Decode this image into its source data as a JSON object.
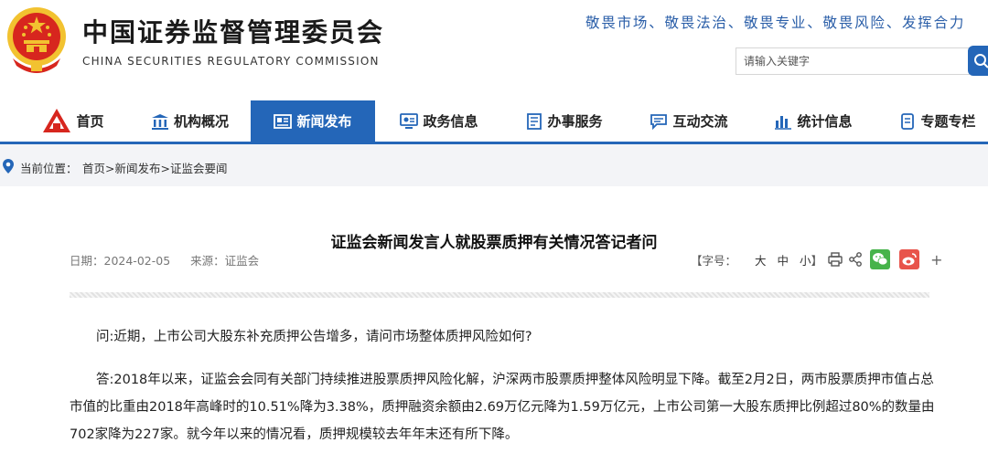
{
  "header": {
    "org_name_cn": "中国证券监督管理委员会",
    "org_name_en": "CHINA SECURITIES REGULATORY COMMISSION",
    "slogan": "敬畏市场、敬畏法治、敬畏专业、敬畏风险、发挥合力",
    "search_placeholder": "请输入关键字"
  },
  "nav": {
    "items": [
      {
        "label": "首页",
        "icon": "emblem-home-icon"
      },
      {
        "label": "机构概况",
        "icon": "building-icon"
      },
      {
        "label": "新闻发布",
        "icon": "news-icon",
        "active": true
      },
      {
        "label": "政务信息",
        "icon": "monitor-icon"
      },
      {
        "label": "办事服务",
        "icon": "form-icon"
      },
      {
        "label": "互动交流",
        "icon": "chat-icon"
      },
      {
        "label": "统计信息",
        "icon": "bar-chart-icon"
      },
      {
        "label": "专题专栏",
        "icon": "document-icon"
      }
    ]
  },
  "breadcrumb": {
    "label": "当前位置：",
    "path": "首页>新闻发布>证监会要闻"
  },
  "article": {
    "title": "证监会新闻发言人就股票质押有关情况答记者问",
    "date": "日期：2024-02-05",
    "source": "来源：证监会",
    "font_size_label": "【字号：",
    "font_sizes": [
      "大",
      "中",
      "小"
    ],
    "font_size_close": "】",
    "plus": "+",
    "paragraphs": [
      "问:近期，上市公司大股东补充质押公告增多，请问市场整体质押风险如何?",
      "答:2018年以来，证监会会同有关部门持续推进股票质押风险化解，沪深两市股票质押整体风险明显下降。截至2月2日，两市股票质押市值占总市值的比重由2018年高峰时的10.51%降为3.38%，质押融资余额由2.69万亿元降为1.59万亿元，上市公司第一大股东质押比例超过80%的数量由702家降为227家。就今年以来的情况看，质押规模较去年年末还有所下降。"
    ]
  },
  "colors": {
    "brand_blue": "#2466b8",
    "emblem_red": "#d7261e",
    "emblem_gold": "#f2c230",
    "wechat_green": "#46b34a",
    "weibo_red": "#e8544b"
  }
}
